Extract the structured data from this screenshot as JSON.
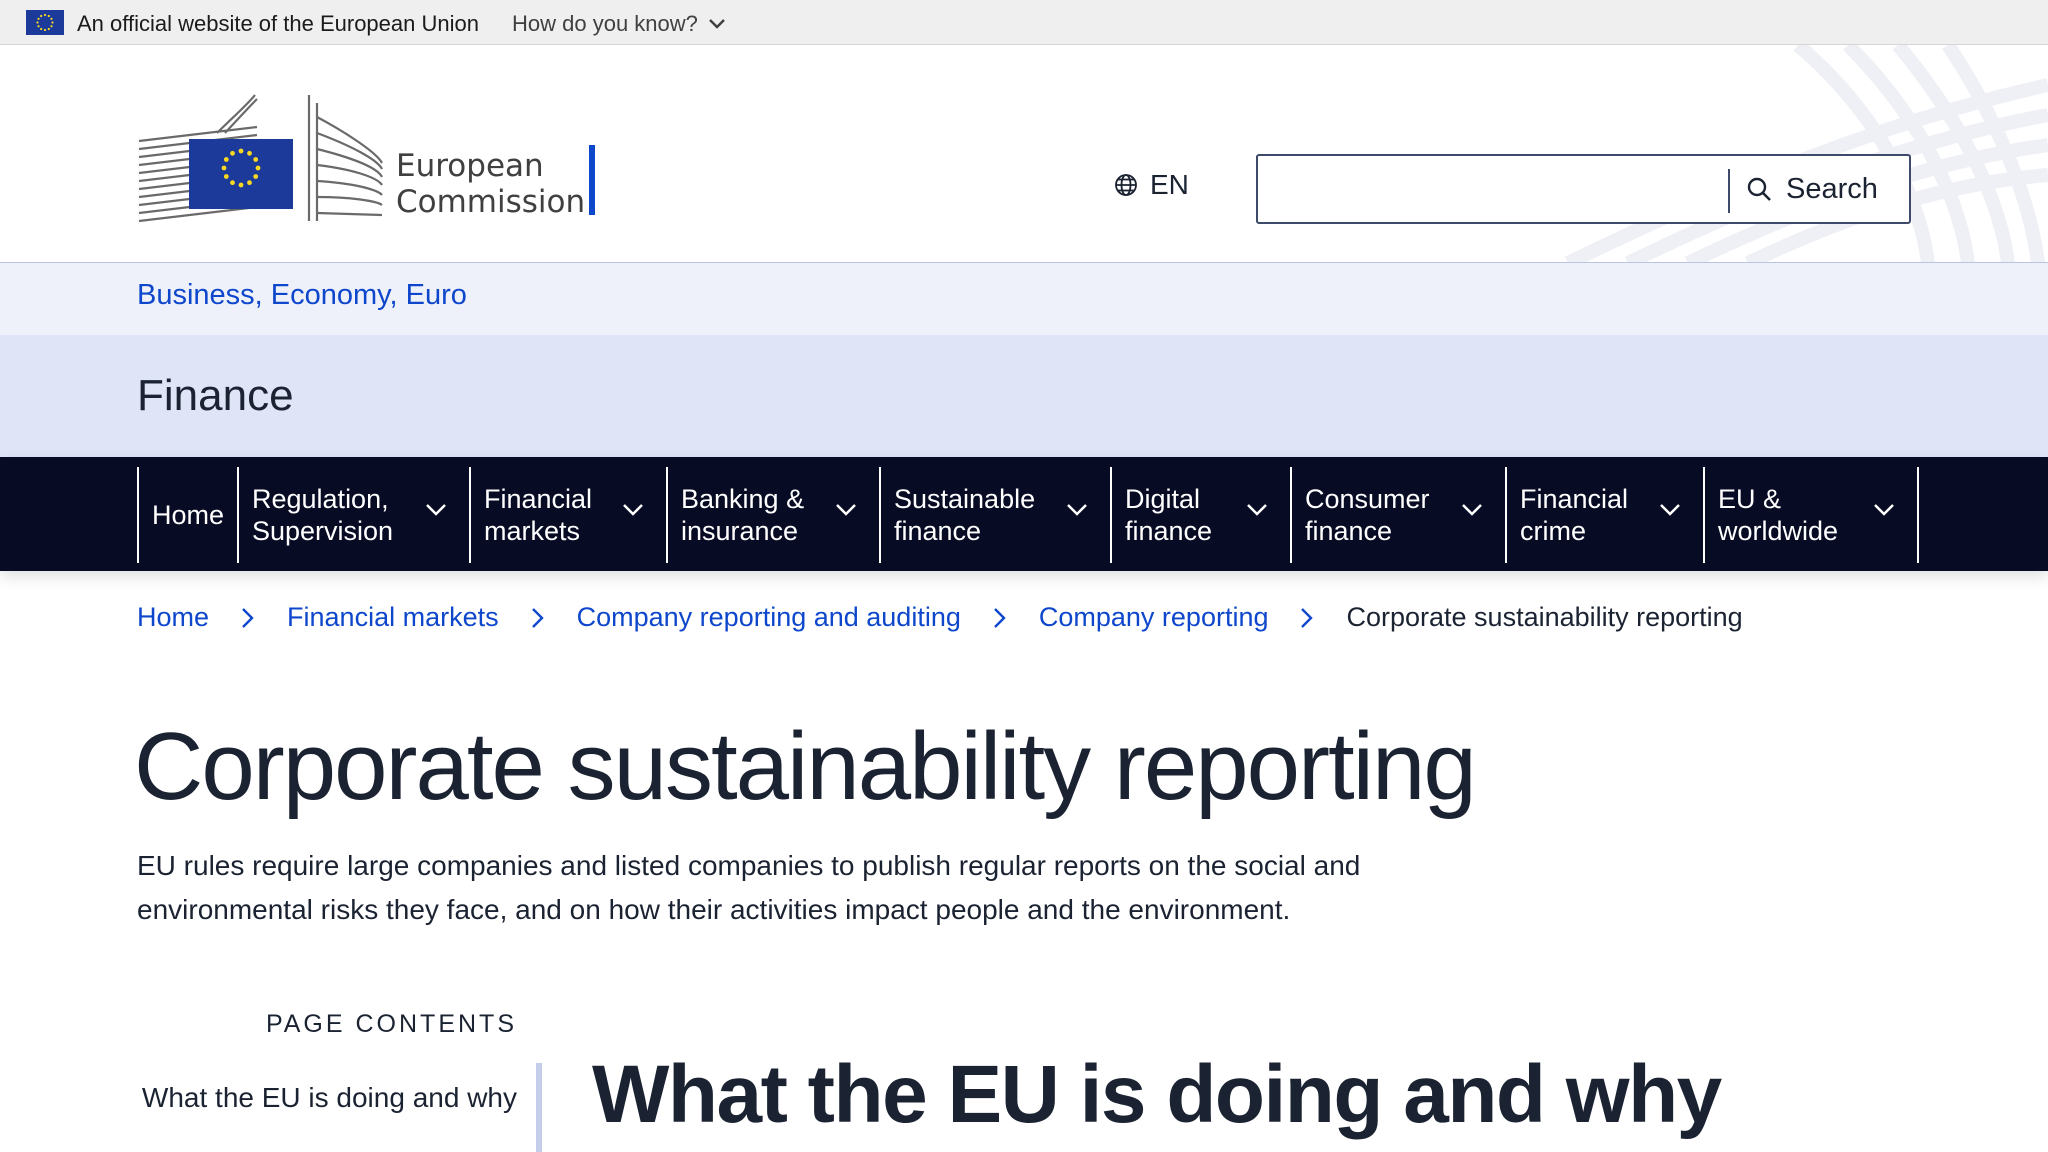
{
  "eu_banner": {
    "text": "An official website of the European Union",
    "link": "How do you know?"
  },
  "header": {
    "logo_line1": "European",
    "logo_line2": "Commission",
    "language": "EN",
    "search_button": "Search",
    "search_value": "",
    "search_placeholder": ""
  },
  "site": {
    "parent": "Business, Economy, Euro",
    "name": "Finance"
  },
  "nav": {
    "items": [
      {
        "label": "Home",
        "has_menu": false
      },
      {
        "label": "Regulation,\nSupervision",
        "has_menu": true
      },
      {
        "label": "Financial\nmarkets",
        "has_menu": true
      },
      {
        "label": "Banking &\ninsurance",
        "has_menu": true
      },
      {
        "label": "Sustainable\nfinance",
        "has_menu": true
      },
      {
        "label": "Digital\nfinance",
        "has_menu": true
      },
      {
        "label": "Consumer\nfinance",
        "has_menu": true
      },
      {
        "label": "Financial\ncrime",
        "has_menu": true
      },
      {
        "label": "EU &\nworldwide",
        "has_menu": true
      }
    ]
  },
  "breadcrumb": {
    "items": [
      "Home",
      "Financial markets",
      "Company reporting and auditing",
      "Company reporting"
    ],
    "current": "Corporate sustainability reporting"
  },
  "page": {
    "title": "Corporate sustainability reporting",
    "intro": "EU rules require large companies and listed companies to publish regular reports on the social and environmental risks they face, and on how their activities impact people and the environment.",
    "contents_label": "PAGE CONTENTS",
    "toc": [
      "What the EU is doing and why"
    ],
    "section_title": "What the EU is doing and why"
  },
  "colors": {
    "link": "#0e47cb",
    "nav_bg": "#070b24",
    "band_light": "#eef1fa",
    "band": "#dfe4f6",
    "text": "#1b2332"
  }
}
